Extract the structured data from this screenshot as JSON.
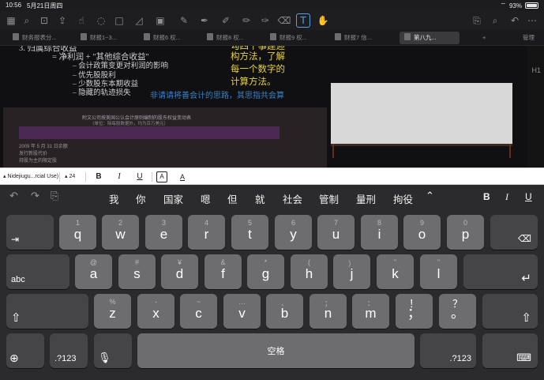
{
  "status": {
    "time": "10:56",
    "date": "5月21日周四",
    "battery": "93%"
  },
  "toolbar": {
    "icons": [
      "grid-icon",
      "search-icon",
      "bookmark-icon",
      "share-icon",
      "close-icon",
      "settings-icon",
      "text-icon",
      "pointer-icon",
      "lasso-icon",
      "shape-icon",
      "chart-icon",
      "pen-icon",
      "highlighter-icon",
      "marker-icon",
      "fountain-pen-icon",
      "eraser-icon",
      "textbox-icon",
      "undo-icon",
      "redo-icon",
      "help-icon",
      "page-icon",
      "more-icon"
    ]
  },
  "tabs": [
    "财务报表分...",
    "财报1~3...",
    "财报6 权...",
    "财报8 权...",
    "财报9 权...",
    "财报7 信...",
    "第八九..."
  ],
  "tabs_right": "管理",
  "document": {
    "line1": "3.   归属综合收益",
    "line2": "= 净利润 + \"其他综合收益\"",
    "bullet1": "– 会计政策变更对利润的影响",
    "bullet2": "– 优先股股利",
    "bullet3": "– 少数股东本期收益",
    "bullet4": "– 隐藏的轨迹损失",
    "yellow1": "勾四个事建迎",
    "yellow2": "构方法，了解",
    "yellow3": "每一个数字的",
    "yellow4": "计算方法。",
    "blue_note": "非请请将善会计的思路，其思指共会算",
    "table_title": "附文公司按美国公认会计原则编制的股东权益变动表",
    "table_subtitle": "（单位：除每股数据外，均为百万美元）",
    "table_row1": "2009 年 5 月 31 日余额",
    "table_row2": "发行新股代价",
    "table_row3": "持股为主的限定股",
    "h1": "H1"
  },
  "formatbar": {
    "font": "Nidejiugu...rcial Use)",
    "size": "24",
    "bold": "B",
    "italic": "I",
    "underline": "U",
    "text_bg": "A",
    "text_color": "A"
  },
  "keyboard": {
    "suggestions": [
      "我",
      "你",
      "国家",
      "嗯",
      "但",
      "就",
      "社会",
      "管制",
      "量刑",
      "拘役"
    ],
    "format": {
      "bold": "B",
      "italic": "I",
      "underline": "U"
    },
    "row1": [
      {
        "main": "q",
        "sub": "1"
      },
      {
        "main": "w",
        "sub": "2"
      },
      {
        "main": "e",
        "sub": "3"
      },
      {
        "main": "r",
        "sub": "4"
      },
      {
        "main": "t",
        "sub": "5"
      },
      {
        "main": "y",
        "sub": "6"
      },
      {
        "main": "u",
        "sub": "7"
      },
      {
        "main": "i",
        "sub": "8"
      },
      {
        "main": "o",
        "sub": "9"
      },
      {
        "main": "p",
        "sub": "0"
      }
    ],
    "row2": [
      {
        "main": "a",
        "sub": "@"
      },
      {
        "main": "s",
        "sub": "#"
      },
      {
        "main": "d",
        "sub": "¥"
      },
      {
        "main": "f",
        "sub": "&"
      },
      {
        "main": "g",
        "sub": "*"
      },
      {
        "main": "h",
        "sub": "("
      },
      {
        "main": "j",
        "sub": "）"
      },
      {
        "main": "k",
        "sub": "\""
      },
      {
        "main": "l",
        "sub": "\""
      }
    ],
    "row3": [
      {
        "main": "z",
        "sub": "%"
      },
      {
        "main": "x",
        "sub": "-"
      },
      {
        "main": "c",
        "sub": "~"
      },
      {
        "main": "v",
        "sub": "…"
      },
      {
        "main": "b",
        "sub": "、"
      },
      {
        "main": "n",
        "sub": "；"
      },
      {
        "main": "m",
        "sub": "："
      },
      {
        "main": "；",
        "sub": "！"
      },
      {
        "main": "。",
        "sub": "？"
      }
    ],
    "abc": "abc",
    "numbers": ".?123",
    "space": "空格"
  }
}
